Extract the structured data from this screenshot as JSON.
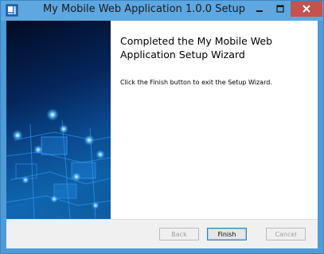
{
  "window": {
    "title": "My Mobile Web Application 1.0.0 Setup"
  },
  "content": {
    "heading": "Completed the My Mobile Web Application Setup Wizard",
    "description": "Click the Finish button to exit the Setup Wizard."
  },
  "buttons": {
    "back": "Back",
    "finish": "Finish",
    "cancel": "Cancel"
  },
  "colors": {
    "titlebar": "#5ea7e0",
    "close_button": "#c75050",
    "banner_dark": "#02102c",
    "banner_glow": "#28a8ff"
  }
}
